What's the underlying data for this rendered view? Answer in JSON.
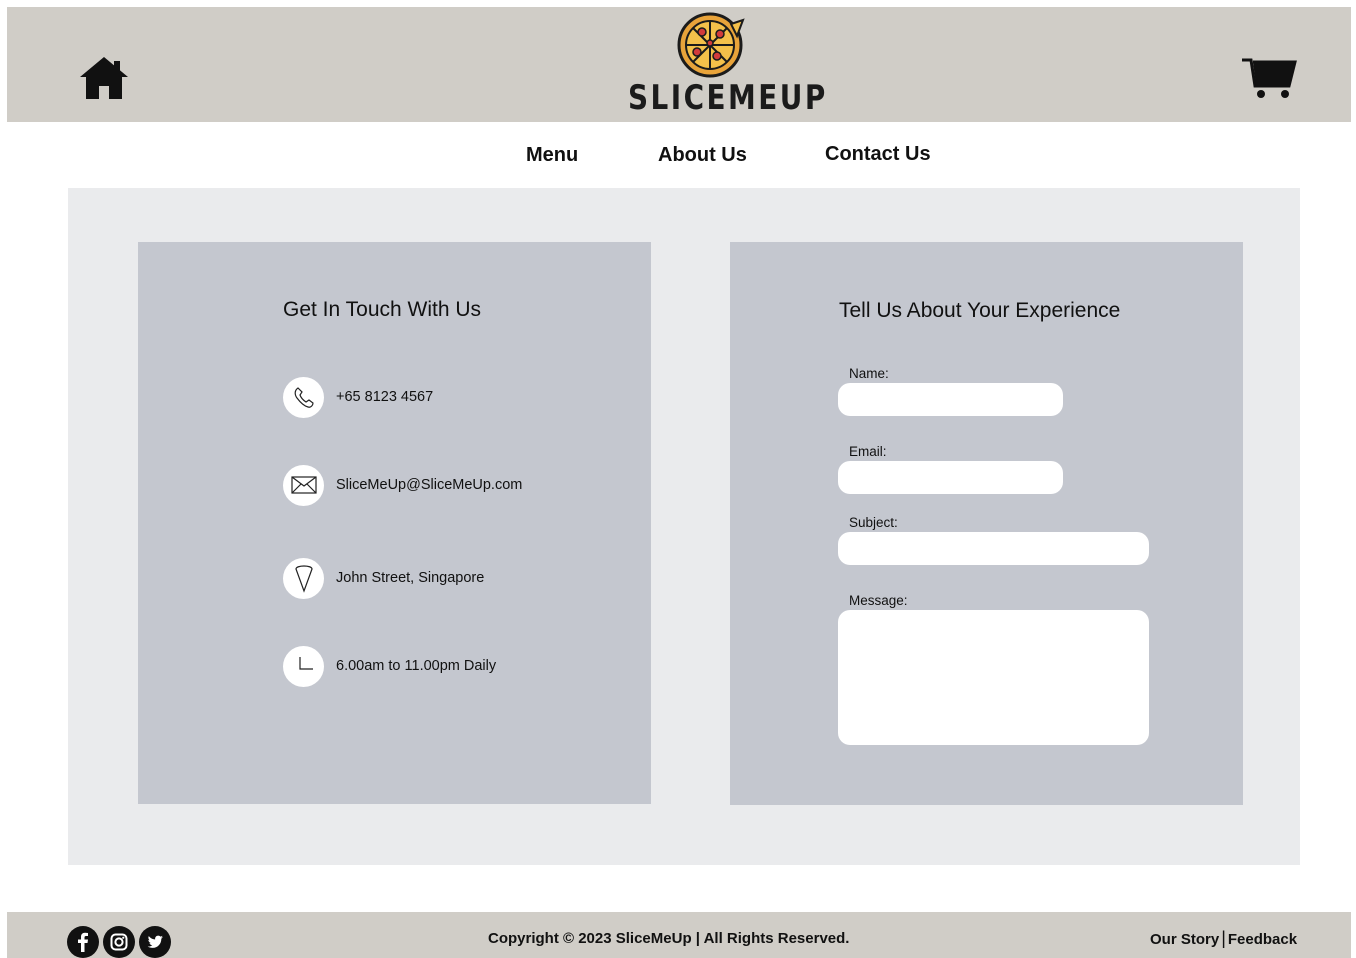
{
  "header": {
    "brand": "SLICEMEUP",
    "icons": {
      "home": "home-icon",
      "cart": "cart-icon",
      "logo": "pizza-logo-icon"
    }
  },
  "nav": {
    "items": [
      {
        "label": "Menu"
      },
      {
        "label": "About Us"
      },
      {
        "label": "Contact Us"
      }
    ]
  },
  "contact_info": {
    "title": "Get In Touch With Us",
    "items": [
      {
        "icon": "phone-icon",
        "text": "+65 8123 4567"
      },
      {
        "icon": "mail-icon",
        "text": "SliceMeUp@SliceMeUp.com"
      },
      {
        "icon": "location-pin-icon",
        "text": "John Street, Singapore"
      },
      {
        "icon": "clock-icon",
        "text": "6.00am to 11.00pm Daily"
      }
    ]
  },
  "feedback_form": {
    "title": "Tell Us About Your Experience",
    "fields": {
      "name": {
        "label": "Name:",
        "value": ""
      },
      "email": {
        "label": "Email:",
        "value": ""
      },
      "subject": {
        "label": "Subject:",
        "value": ""
      },
      "message": {
        "label": "Message:",
        "value": ""
      }
    }
  },
  "footer": {
    "social": [
      "facebook-icon",
      "instagram-icon",
      "twitter-icon"
    ],
    "copyright": "Copyright © 2023 SliceMeUp | All Rights Reserved.",
    "links": [
      {
        "label": "Our Story"
      },
      {
        "label": "Feedback"
      }
    ],
    "separator": "|"
  },
  "colors": {
    "header_bg": "#d0cdc7",
    "main_bg": "#eaebed",
    "panel_bg": "#c4c7cf",
    "field_bg": "#ffffff"
  }
}
